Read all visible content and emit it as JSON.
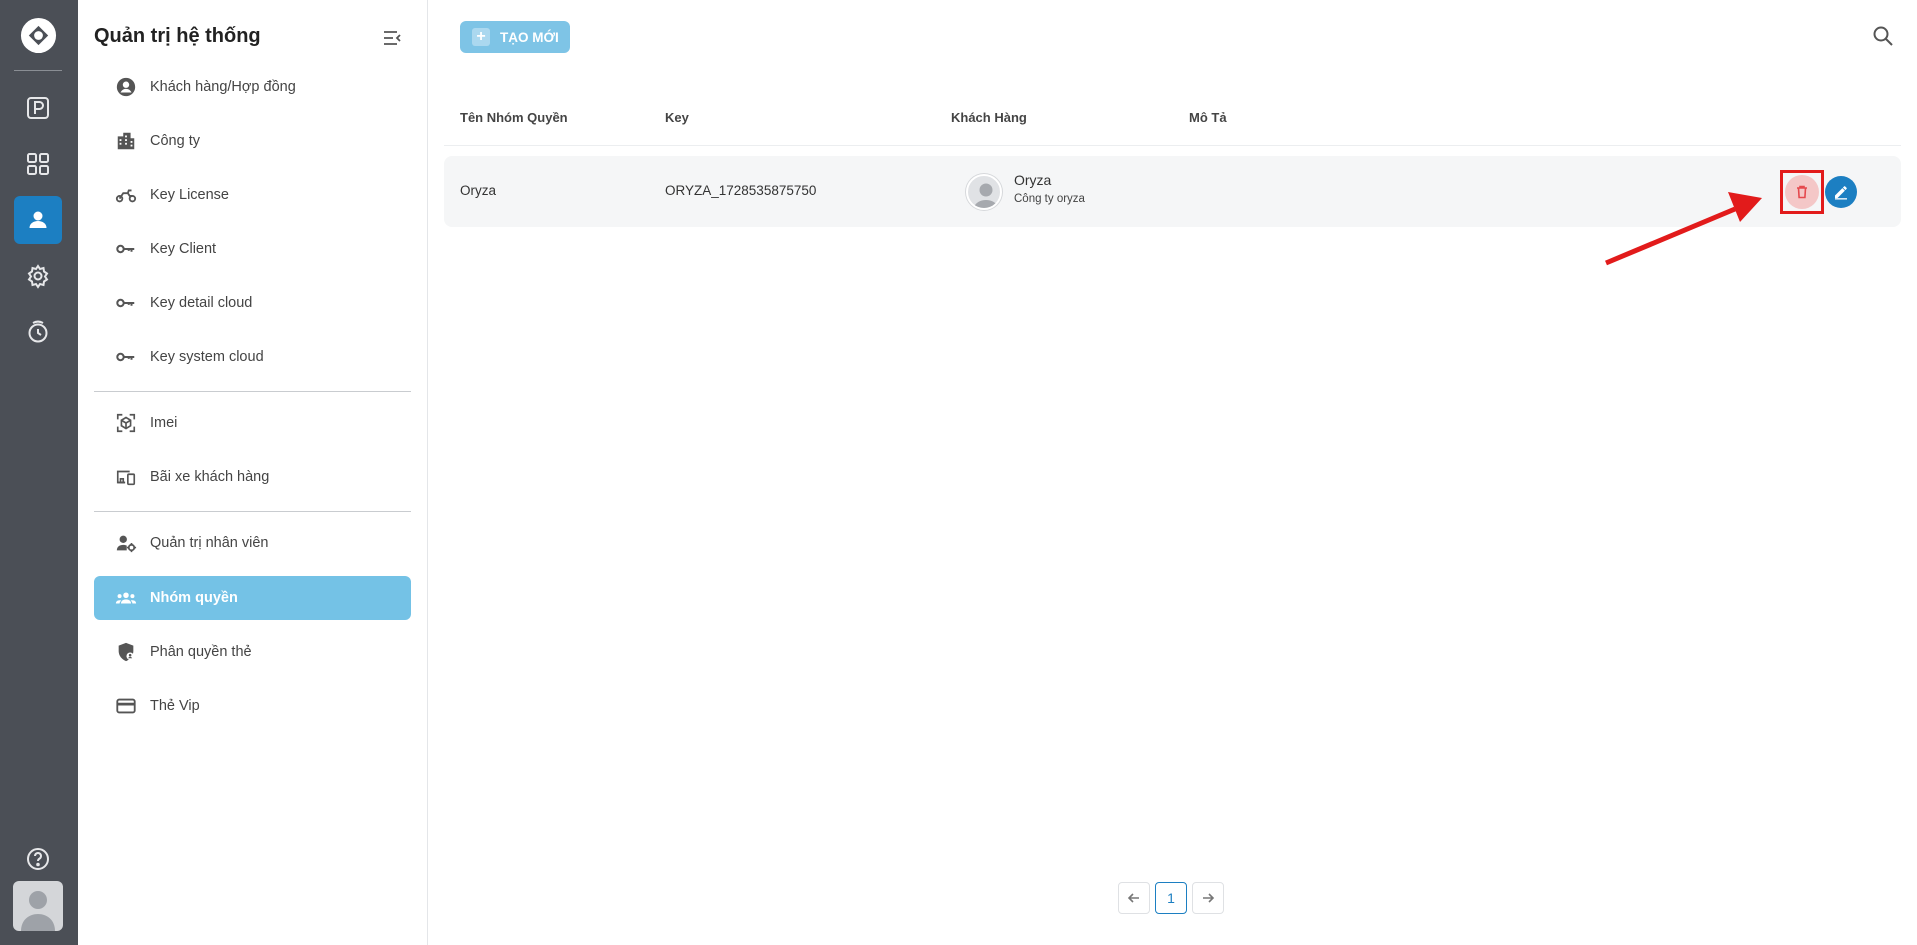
{
  "sidebar": {
    "title": "Quản trị hệ thống",
    "groups": [
      [
        {
          "label": "Khách hàng/Hợp đồng",
          "icon": "account-circle-icon"
        },
        {
          "label": "Công ty",
          "icon": "building-icon"
        },
        {
          "label": "Key License",
          "icon": "motorbike-icon"
        },
        {
          "label": "Key Client",
          "icon": "key-icon"
        },
        {
          "label": "Key detail cloud",
          "icon": "key-icon"
        },
        {
          "label": "Key system cloud",
          "icon": "key-icon"
        }
      ],
      [
        {
          "label": "Imei",
          "icon": "scan-cube-icon"
        },
        {
          "label": "Bãi xe khách hàng",
          "icon": "devices-icon"
        }
      ],
      [
        {
          "label": "Quản trị nhân viên",
          "icon": "user-gear-icon"
        },
        {
          "label": "Nhóm quyền",
          "icon": "group-icon",
          "active": true
        },
        {
          "label": "Phân quyền thẻ",
          "icon": "shield-user-icon"
        },
        {
          "label": "Thẻ Vip",
          "icon": "card-icon"
        }
      ]
    ]
  },
  "toolbar": {
    "create_label": "TẠO MỚI"
  },
  "table": {
    "headers": [
      "Tên Nhóm Quyền",
      "Key",
      "Khách Hàng",
      "Mô Tả"
    ],
    "rows": [
      {
        "name": "Oryza",
        "key": "ORYZA_1728535875750",
        "customer_name": "Oryza",
        "customer_company": "Công ty oryza",
        "description": ""
      }
    ]
  },
  "pagination": {
    "current": "1"
  },
  "colors": {
    "accent": "#1c7fc2",
    "rail": "#4b4f56",
    "active_menu": "#74c2e6",
    "highlight": "#e21b1b"
  }
}
